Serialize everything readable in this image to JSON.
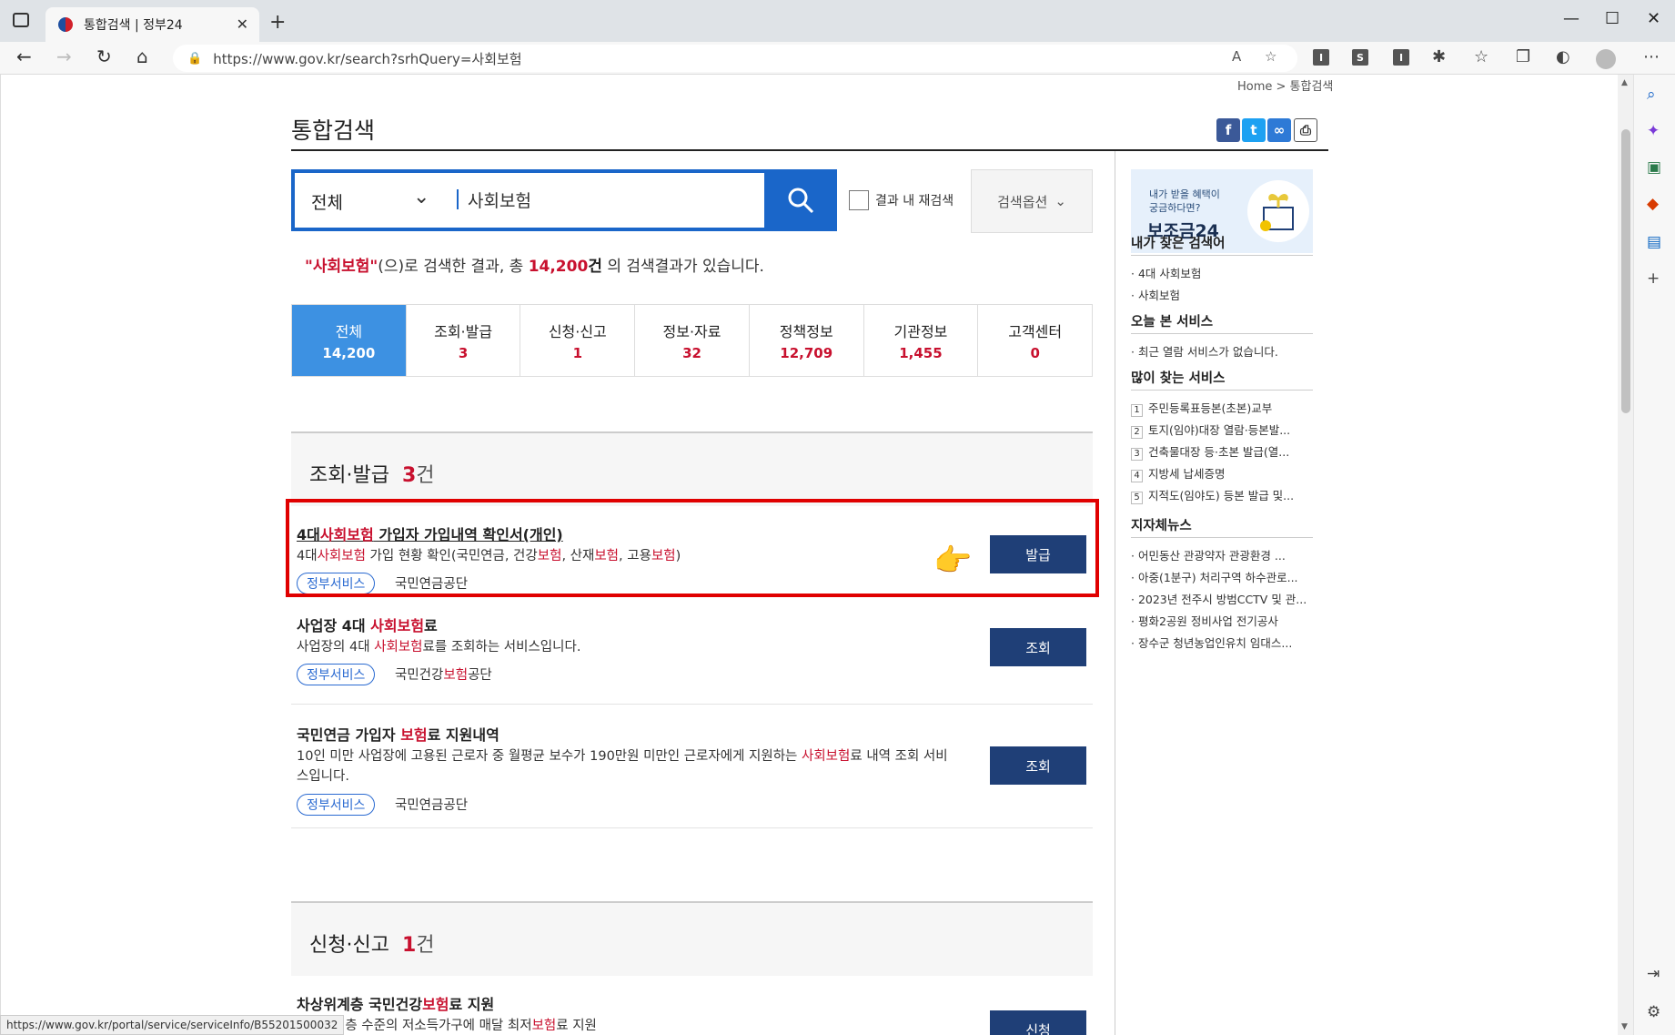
{
  "browser": {
    "tab_title": "통합검색 | 정부24",
    "url": "https://www.gov.kr/search?srhQuery=사회보험",
    "status_url": "https://www.gov.kr/portal/service/serviceInfo/B55201500032",
    "extensions": [
      "I",
      "S",
      "I"
    ]
  },
  "breadcrumb": "Home > 통합검색",
  "page_title": "통합검색",
  "search": {
    "scope": "전체",
    "query": "사회보험",
    "within_label": "결과 내 재검색",
    "options_label": "검색옵션"
  },
  "summary": {
    "term": "\"사회보험\"",
    "middle": "(으)로 검색한 결과, 총 ",
    "count": "14,200",
    "unit": "건",
    "tail": " 의 검색결과가 있습니다."
  },
  "categories": [
    {
      "label": "전체",
      "count": "14,200"
    },
    {
      "label": "조회·발급",
      "count": "3"
    },
    {
      "label": "신청·신고",
      "count": "1"
    },
    {
      "label": "정보·자료",
      "count": "32"
    },
    {
      "label": "정책정보",
      "count": "12,709"
    },
    {
      "label": "기관정보",
      "count": "1,455"
    },
    {
      "label": "고객센터",
      "count": "0"
    }
  ],
  "section1": {
    "label": "조회·발급",
    "count": "3",
    "unit": "건"
  },
  "section2": {
    "label": "신청·신고",
    "count": "1",
    "unit": "건"
  },
  "results": [
    {
      "title_a": "4대",
      "title_hl": "사회보험",
      "title_b": " 가입자 가입내역 확인서(개인)",
      "desc_a": "4대",
      "desc_hl1": "사회보험",
      "desc_b": " 가입 현황 확인(국민연금, 건강",
      "desc_hl2": "보험",
      "desc_c": ", 산재",
      "desc_hl3": "보험",
      "desc_d": ", 고용",
      "desc_hl4": "보험",
      "desc_e": ")",
      "tag": "정부서비스",
      "org": "국민연금공단",
      "button": "발급"
    },
    {
      "title_a": "사업장 4대 ",
      "title_hl": "사회보험",
      "title_b": "료",
      "desc_a": "사업장의 4대 ",
      "desc_hl1": "사회보험",
      "desc_b": "료를 조회하는 서비스입니다.",
      "tag": "정부서비스",
      "org_a": "국민건강",
      "org_hl": "보험",
      "org_b": "공단",
      "button": "조회"
    },
    {
      "title_a": "국민연금 가입자 ",
      "title_hl": "보험",
      "title_b": "료 지원내역",
      "desc_a": "10인 미만 사업장에 고용된 근로자 중 월평균 보수가 190만원 미만인 근로자에게 지원하는 ",
      "desc_hl1": "사회보험",
      "desc_b": "료 내역 조회 서비",
      "desc_line2": "스입니다.",
      "tag": "정부서비스",
      "org": "국민연금공단",
      "button": "조회"
    },
    {
      "title_a": "차상위계층 국민건강",
      "title_hl": "보험",
      "title_b": "료 지원",
      "desc_a": "차상위계층 수준의 저소득가구에 매달 최저",
      "desc_hl1": "보험",
      "desc_b": "료 지원",
      "button": "신청"
    }
  ],
  "sidebar": {
    "banner_line1": "내가 받을 혜택이",
    "banner_line2": "궁금하다면?",
    "banner_title": "보조금24",
    "my_searches_title": "내가 찾은 검색어",
    "my_searches": [
      "4대 사회보험",
      "사회보험"
    ],
    "today_title": "오늘 본 서비스",
    "today_empty": "최근 열람 서비스가 없습니다.",
    "popular_title": "많이 찾는 서비스",
    "popular": [
      "주민등록표등본(초본)교부",
      "토지(임야)대장 열람·등본발...",
      "건축물대장 등·초본 발급(열...",
      "지방세 납세증명",
      "지적도(임야도) 등본 발급 및..."
    ],
    "news_title": "지자체뉴스",
    "news": [
      "어민동산 관광약자 관광환경 ...",
      "아중(1분구) 처리구역 하수관로...",
      "2023년 전주시 방범CCTV 및 관...",
      "평화2공원 정비사업 전기공사",
      "장수군 청년농업인유치 임대스..."
    ]
  }
}
